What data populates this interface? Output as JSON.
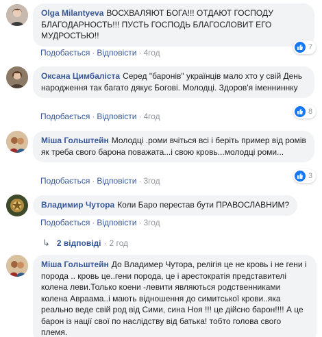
{
  "comments": [
    {
      "author": "Olga Milantyeva",
      "text": "ВОСХВАЛЯЮТ БОГА!!! ОТДАЮТ ГОСПОДУ БЛАГОДАРНОСТЬ!!! ПУСТЬ ГОСПОДЬ БЛАГОСЛОВИТ ЕГО МУДРОСТЬЮ!!",
      "like": "Подобається",
      "reply": "Відповісти",
      "time": "4год",
      "reactions": "7"
    },
    {
      "author": "Оксана Цимбаліста",
      "text": "Серед \"баронів\" українців мало хто у свій День народження так багато дякує Богові. Молодці. Здоров'я іменниннку",
      "like": "Подобається",
      "reply": "Відповісти",
      "time": "4год",
      "reactions": "8"
    },
    {
      "author": "Міша Гольштейн",
      "text": "Молодці .роми вчіться всі і беріть пример від ромів як треба свого барона поважата...і свою кровь...молодці роми...",
      "like": "Подобається",
      "reply": "Відповісти",
      "time": "3год",
      "reactions": "3"
    },
    {
      "author": "Владимир Чутора",
      "text": "Коли Баро перестав бути ПРАВОСЛАВНИМ?",
      "like": "Подобається",
      "reply": "Відповісти",
      "time": "3год",
      "replies_label": "2 відповіді",
      "replies_time": "2 год"
    },
    {
      "author": "Міша Гольштейн",
      "text": "До Владимер Чутора, релігія це не кровь і не гени і порода .. кровь це..гени порода, це і арестократія представителі колена леви.Только коени -левити являються родственниками колена Авраама..і мають відношення до симитської крови..яка реально веде свій род від Сими, сина Ноя !!! це дійсно барон!!!! А це барон із нації свої по наслідству від батька! тобто голова свого племя."
    }
  ],
  "colors": {
    "link": "#385898",
    "bubble": "#f2f3f5",
    "like": "#1877f2",
    "meta": "#90949c"
  }
}
